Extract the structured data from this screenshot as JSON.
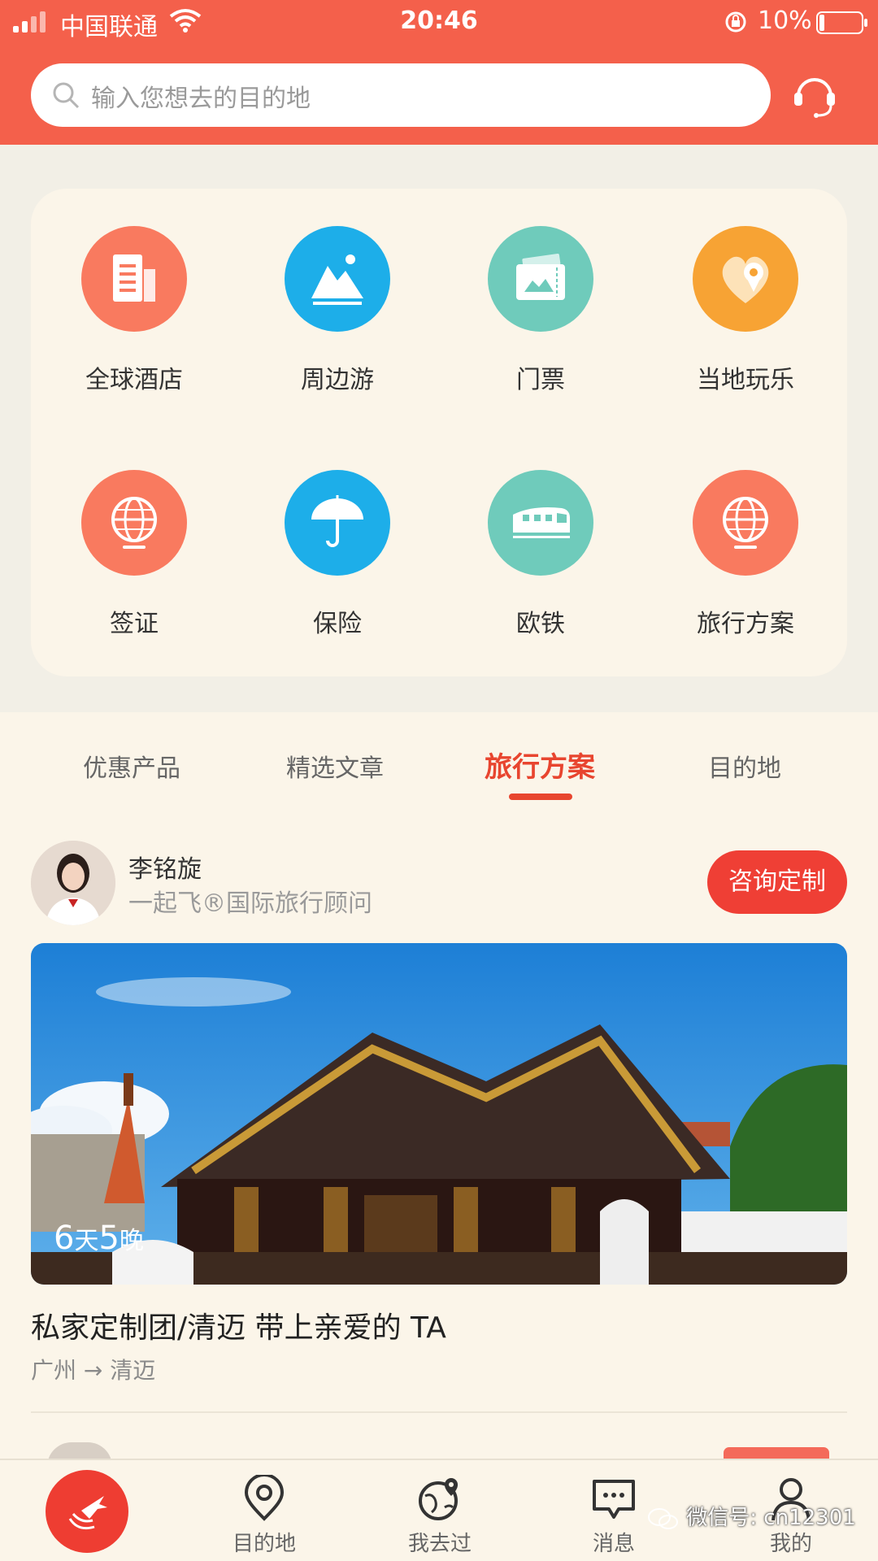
{
  "status_bar": {
    "carrier": "中国联通",
    "time": "20:46",
    "battery": "10%"
  },
  "search": {
    "placeholder": "输入您想去的目的地"
  },
  "categories": [
    {
      "label": "全球酒店",
      "icon": "hotel-icon",
      "color": "#f97a5f"
    },
    {
      "label": "周边游",
      "icon": "mountain-icon",
      "color": "#1daee9"
    },
    {
      "label": "门票",
      "icon": "ticket-icon",
      "color": "#6fcbbb"
    },
    {
      "label": "当地玩乐",
      "icon": "heart-location-icon",
      "color": "#f7a334"
    },
    {
      "label": "签证",
      "icon": "globe-icon",
      "color": "#f97a5f"
    },
    {
      "label": "保险",
      "icon": "umbrella-icon",
      "color": "#1daee9"
    },
    {
      "label": "欧铁",
      "icon": "train-icon",
      "color": "#6fcbbb"
    },
    {
      "label": "旅行方案",
      "icon": "globe-icon",
      "color": "#f97a5f"
    }
  ],
  "tabs": [
    {
      "label": "优惠产品",
      "active": false
    },
    {
      "label": "精选文章",
      "active": false
    },
    {
      "label": "旅行方案",
      "active": true
    },
    {
      "label": "目的地",
      "active": false
    }
  ],
  "advisor": {
    "name": "李铭旋",
    "title": "一起飞®国际旅行顾问",
    "button": "咨询定制"
  },
  "trip": {
    "days": "6",
    "days_unit": "天",
    "nights": "5",
    "nights_unit": "晚",
    "title": "私家定制团/清迈 带上亲爱的 TA",
    "route": "广州 → 清迈"
  },
  "bottom_nav": [
    {
      "label": "目的地",
      "icon": "location-pin-icon"
    },
    {
      "label": "我去过",
      "icon": "globe-pin-icon"
    },
    {
      "label": "消息",
      "icon": "message-icon"
    },
    {
      "label": "我的",
      "icon": "user-icon"
    }
  ],
  "watermark": "微信号: cn12301",
  "colors": {
    "header": "#f4604b",
    "accent": "#e8452f",
    "button": "#ef3f35"
  }
}
